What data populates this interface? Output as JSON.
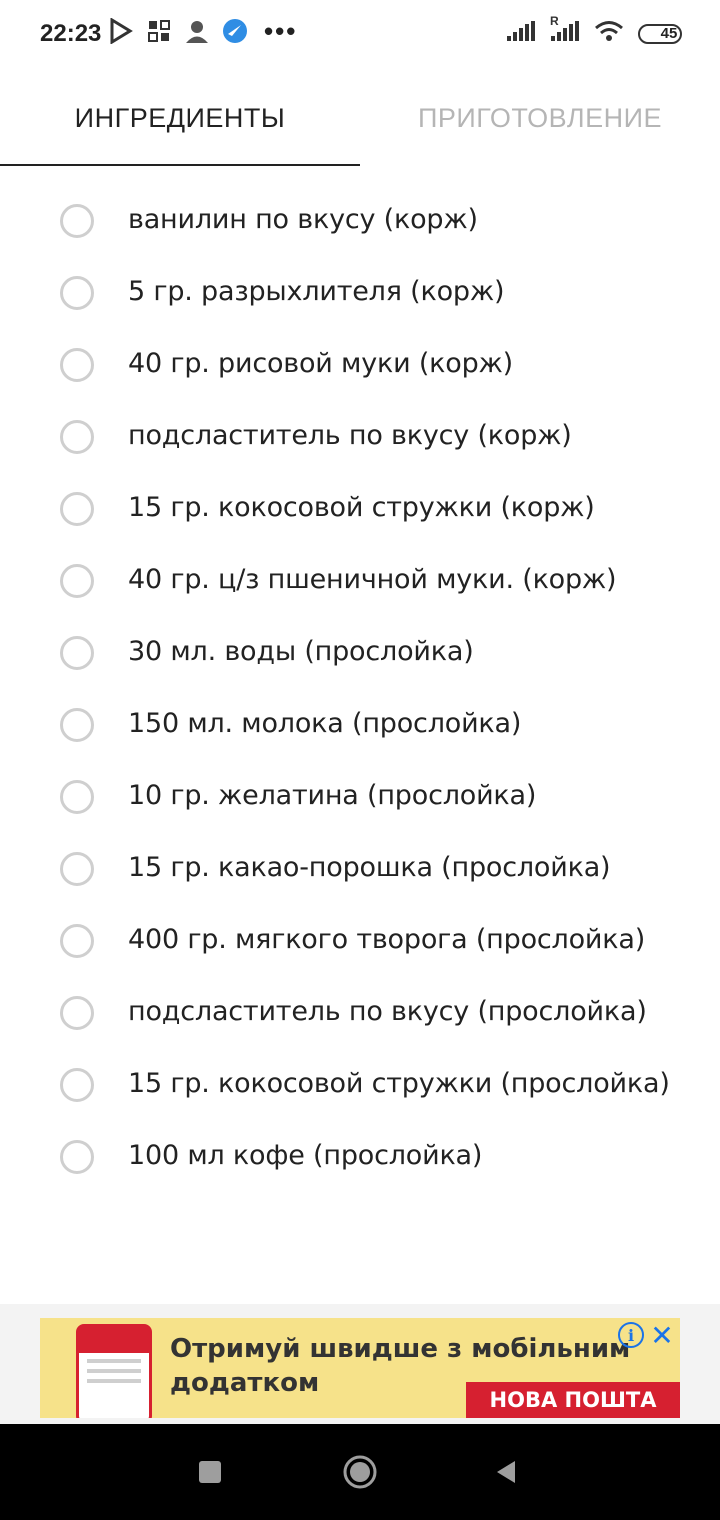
{
  "status_bar": {
    "time": "22:23",
    "left_icons": [
      "play-store-icon",
      "vk-icon",
      "avatar-icon",
      "telegram-icon"
    ],
    "more": "•••",
    "right_icons": [
      "signal-icon",
      "signal-roaming-icon",
      "wifi-icon"
    ],
    "roaming_label": "R",
    "battery": "45",
    "battery_level": 0.45
  },
  "tabs": [
    {
      "label": "ИНГРЕДИЕНТЫ",
      "active": true
    },
    {
      "label": "ПРИГОТОВЛЕНИЕ",
      "active": false
    }
  ],
  "ingredients": [
    {
      "label": "ванилин по вкусу (корж)",
      "checked": false
    },
    {
      "label": "5 гр. разрыхлителя (корж)",
      "checked": false
    },
    {
      "label": "40 гр. рисовой муки (корж)",
      "checked": false
    },
    {
      "label": "подсластитель по вкусу (корж)",
      "checked": false
    },
    {
      "label": "15 гр. кокосовой стружки (корж)",
      "checked": false
    },
    {
      "label": "40 гр. ц/з пшеничной муки. (корж)",
      "checked": false
    },
    {
      "label": "30 мл. воды (прослойка)",
      "checked": false
    },
    {
      "label": "150 мл. молока (прослойка)",
      "checked": false
    },
    {
      "label": "10 гр. желатина (прослойка)",
      "checked": false
    },
    {
      "label": "15 гр. какао-порошка (прослойка)",
      "checked": false
    },
    {
      "label": "400 гр. мягкого творога (прослойка)",
      "checked": false
    },
    {
      "label": "подсластитель по вкусу (прослойка)",
      "checked": false
    },
    {
      "label": "15 гр. кокосовой стружки (прослойка)",
      "checked": false
    },
    {
      "label": "100 мл кофе (прослойка)",
      "checked": false
    }
  ],
  "ad": {
    "text": "Отримуй швидше з мобільним додатком",
    "brand": "НОВА ПОШТА",
    "info_symbol": "i",
    "close_symbol": "✕"
  },
  "nav": {
    "buttons": [
      "recents-button",
      "home-button",
      "back-button"
    ]
  },
  "colors": {
    "accent_dark": "#222222",
    "tab_inactive": "#b5b5b5",
    "radio_border": "#cfcfcf",
    "ad_background": "#f6e28a",
    "brand_red": "#d62030",
    "ad_icon_blue": "#1a73e8",
    "battery_fill": "#f5c742"
  }
}
